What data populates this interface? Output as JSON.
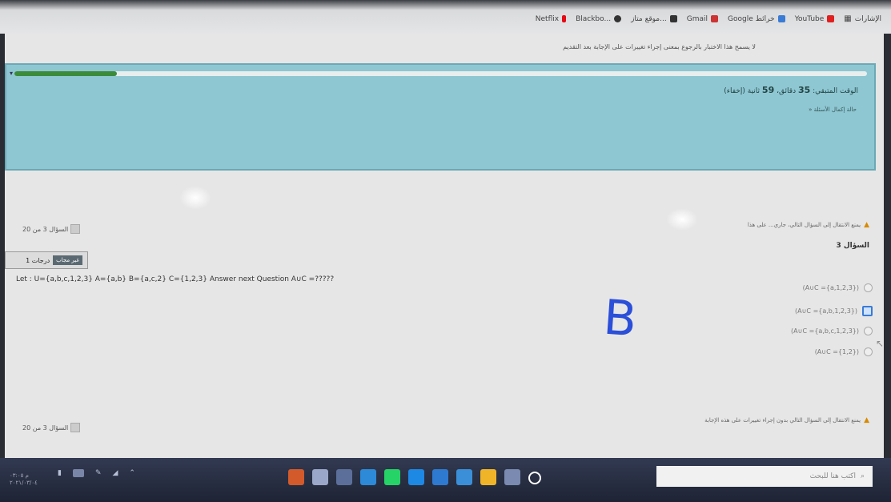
{
  "bookmarks": {
    "label": "الإشارات",
    "items": [
      {
        "label": "YouTube",
        "color": "#e02020"
      },
      {
        "label": "Google خرائط",
        "color": "#3a7bd5"
      },
      {
        "label": "Gmail",
        "color": "#c33"
      },
      {
        "label": "موقع متاز...",
        "color": "#333"
      },
      {
        "label": "Blackbo...",
        "color": "#333"
      },
      {
        "label": "Netflix",
        "color": "#e50914"
      }
    ]
  },
  "notice": "لا يسمح هذا الاختبار بالرجوع بمعنى إجراء تغييرات على الإجابة بعد التقديم",
  "timer": {
    "progress": 0.12,
    "label": "الوقت المتبقي:",
    "minutes": "35",
    "minutes_label": "دقائق،",
    "seconds": "59",
    "seconds_label": "ثانية (إخفاء)",
    "nav_link": "» حالة إكمال الأسئلة"
  },
  "question_counter_top": "السؤال 3 من 20",
  "question_counter_bottom": "السؤال 3 من 20",
  "warning_top": "يمنع الانتقال إلى السؤال التالي، جاري... على هذا",
  "warning_bottom": "يمنع الانتقال إلى السؤال التالي بدون إجراء تغييرات على هذه الإجابة",
  "question": {
    "heading": "السؤال 3",
    "marks": "1 درجات",
    "flag_label": "غير مجاب",
    "text": "Let : U={a,b,c,1,2,3} A={a,b} B={a,c,2} C={1,2,3} Answer next Question A∪C =?????",
    "options": [
      {
        "label": "(A∪C ={a,1,2,3})",
        "selected": false
      },
      {
        "label": "(A∪C ={a,b,1,2,3})",
        "selected": true
      },
      {
        "label": "(A∪C ={a,b,c,1,2,3})",
        "selected": false
      },
      {
        "label": "(A∪C ={1,2})",
        "selected": false
      }
    ]
  },
  "annotation": "B",
  "taskbar": {
    "search_placeholder": "اكتب هنا للبحث",
    "clock_time": "م ٠٣:٠٥",
    "clock_date": "٢٠٢١/٠٣/٠٤",
    "app_colors": [
      "#d35a2a",
      "#9aa7c8",
      "#5b6f9a",
      "#2c8ad8",
      "#25d366",
      "#1e88e5",
      "#2e7ad1",
      "#3a8fd8",
      "#f0b429",
      "#7a8ab0",
      "#ffffff"
    ]
  }
}
